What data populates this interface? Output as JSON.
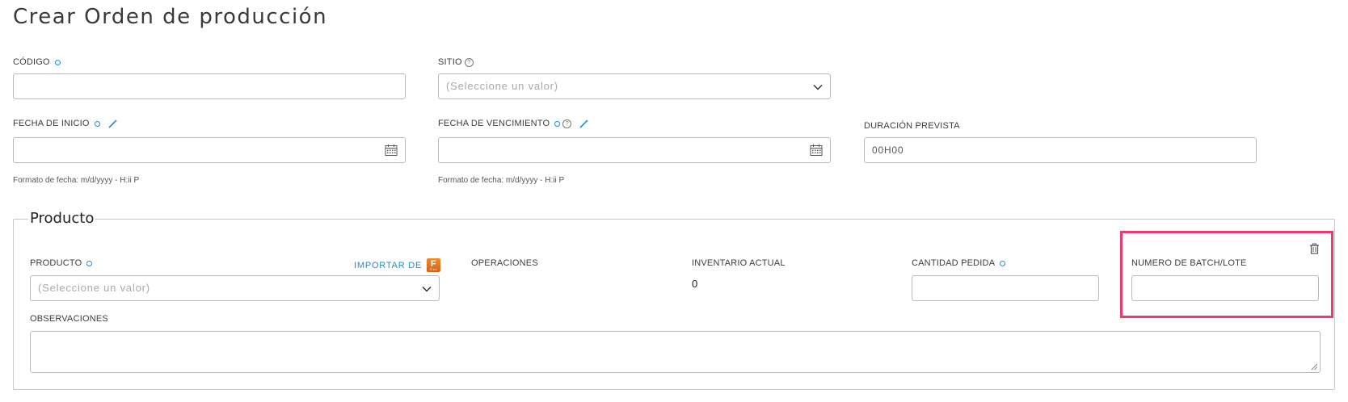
{
  "page": {
    "title": "Crear Orden de producción"
  },
  "form": {
    "codigo": {
      "label": "CÓDIGO",
      "value": ""
    },
    "sitio": {
      "label": "SITIO",
      "placeholder": "(Seleccione un valor)"
    },
    "fecha_inicio": {
      "label": "FECHA DE INICIO",
      "value": "",
      "hint": "Formato de fecha: m/d/yyyy - H:ii P"
    },
    "fecha_vencimiento": {
      "label": "FECHA DE VENCIMIENTO",
      "value": "",
      "hint": "Formato de fecha: m/d/yyyy - H:ii P"
    },
    "duracion": {
      "label": "DURACIÓN PREVISTA",
      "value": "00H00"
    }
  },
  "producto_section": {
    "legend": "Producto",
    "producto": {
      "label": "PRODUCTO",
      "placeholder": "(Seleccione un valor)",
      "import_label": "IMPORTAR DE",
      "import_badge": "F",
      "import_badge_sub": "Exc"
    },
    "operaciones": {
      "label": "OPERACIONES"
    },
    "inventario": {
      "label": "INVENTARIO ACTUAL",
      "value": "0"
    },
    "cantidad": {
      "label": "CANTIDAD PEDIDA",
      "value": ""
    },
    "batch": {
      "label": "NUMERO DE BATCH/LOTE",
      "value": ""
    },
    "observaciones": {
      "label": "OBSERVACIONES",
      "value": ""
    }
  },
  "icons": {
    "required": "required-dot-icon",
    "help": "help-circle-icon",
    "wand": "magic-wand-icon",
    "calendar": "calendar-icon",
    "chevron": "chevron-down-icon",
    "trash": "trash-icon"
  },
  "colors": {
    "accent": "#1a8fd1",
    "highlight": "#ee3b6c",
    "import_badge": "#f38a22"
  }
}
